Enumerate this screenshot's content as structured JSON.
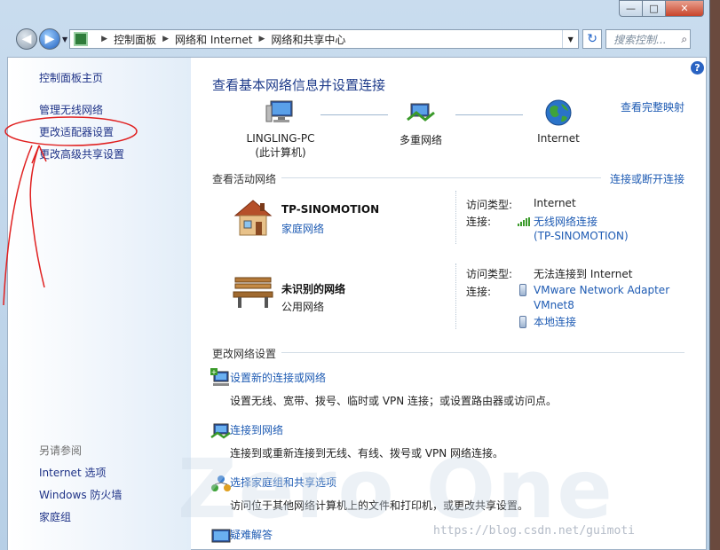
{
  "window": {
    "min": "—",
    "max": "□",
    "close": "✕"
  },
  "address": {
    "crumbs": [
      "控制面板",
      "网络和 Internet",
      "网络和共享中心"
    ],
    "search_placeholder": "搜索控制..."
  },
  "sidebar": {
    "items": [
      "控制面板主页",
      "管理无线网络",
      "更改适配器设置",
      "更改高级共享设置"
    ],
    "see_also_heading": "另请参阅",
    "see_also": [
      "Internet 选项",
      "Windows 防火墙",
      "家庭组"
    ]
  },
  "main": {
    "title": "查看基本网络信息并设置连接",
    "full_map_link": "查看完整映射",
    "nodes": [
      {
        "label": "LINGLING-PC",
        "sublabel": "(此计算机)"
      },
      {
        "label": "多重网络",
        "sublabel": ""
      },
      {
        "label": "Internet",
        "sublabel": ""
      }
    ],
    "active_label": "查看活动网络",
    "connect_link": "连接或断开连接",
    "networks": [
      {
        "name": "TP-SINOMOTION",
        "type": "家庭网络",
        "access_key": "访问类型:",
        "access_val": "Internet",
        "conn_key": "连接:",
        "conn_vals": [
          "无线网络连接",
          "(TP-SINOMOTION)"
        ]
      },
      {
        "name": "未识别的网络",
        "type": "公用网络",
        "access_key": "访问类型:",
        "access_val": "无法连接到 Internet",
        "conn_key": "连接:",
        "conn_vals": [
          "VMware Network Adapter",
          "VMnet8",
          "本地连接"
        ]
      }
    ],
    "change_label": "更改网络设置",
    "tasks": [
      {
        "title": "设置新的连接或网络",
        "desc": "设置无线、宽带、拨号、临时或 VPN 连接；或设置路由器或访问点。"
      },
      {
        "title": "连接到网络",
        "desc": "连接到或重新连接到无线、有线、拨号或 VPN 网络连接。"
      },
      {
        "title": "选择家庭组和共享选项",
        "desc": "访问位于其他网络计算机上的文件和打印机，或更改共享设置。"
      },
      {
        "title": "疑难解答",
        "desc": ""
      }
    ]
  },
  "watermark": {
    "logo": "Zero One",
    "url": "https://blog.csdn.net/guimoti"
  },
  "colors": {
    "link": "#1e5bb3",
    "title": "#1e3b8a",
    "annotation": "#e02020"
  }
}
